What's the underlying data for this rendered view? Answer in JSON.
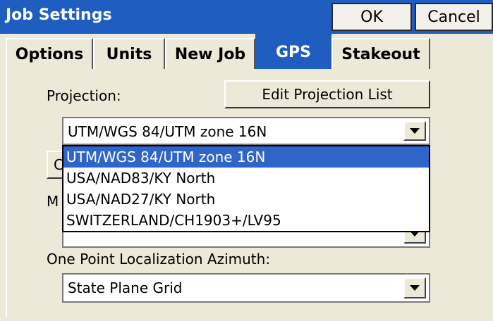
{
  "window": {
    "title": "Job Settings",
    "ok_label": "OK",
    "cancel_label": "Cancel"
  },
  "tabs": [
    {
      "label": "Options"
    },
    {
      "label": "Units"
    },
    {
      "label": "New Job"
    },
    {
      "label": "GPS",
      "active": true
    },
    {
      "label": "Stakeout"
    }
  ],
  "gps": {
    "projection_label": "Projection:",
    "edit_projection_button": "Edit Projection List",
    "projection_value": "UTM/WGS 84/UTM zone 16N",
    "projection_options": [
      "UTM/WGS 84/UTM zone 16N",
      "USA/NAD83/KY North",
      "USA/NAD27/KY North",
      "SWITZERLAND/CH1903+/LV95"
    ],
    "partially_hidden_button_char": "C",
    "partially_hidden_label_char": "M",
    "azimuth_label": "One Point Localization Azimuth:",
    "azimuth_value": "State Plane Grid"
  },
  "colors": {
    "title_bar": "#1f5dc0",
    "selection": "#2f65c8",
    "dialog_bg": "#ece9d8"
  }
}
